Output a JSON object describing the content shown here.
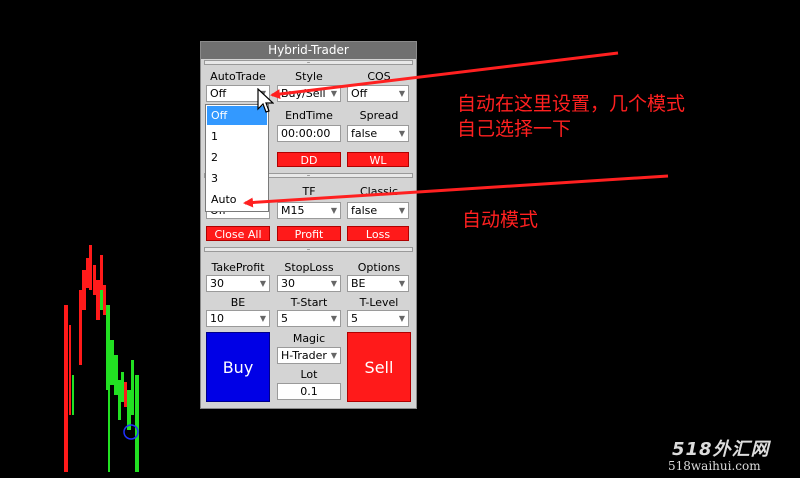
{
  "colors": {
    "accent_red": "#ff1a1a",
    "buy_blue": "#0000e6",
    "panel_bg": "#d4d4d4",
    "annotation": "#ff2020",
    "highlight": "#3399ff"
  },
  "panel": {
    "title": "Hybrid-Trader",
    "sep": "–",
    "row1": {
      "autotrade": {
        "label": "AutoTrade",
        "value": "Off"
      },
      "style": {
        "label": "Style",
        "value": "Buy/Sell"
      },
      "cos": {
        "label": "COS",
        "value": "Off"
      }
    },
    "row2": {
      "endtime": {
        "label": "EndTime",
        "value": "00:00:00"
      },
      "spread": {
        "label": "Spread",
        "value": "false"
      }
    },
    "buttons1": {
      "dd": "DD",
      "wl": "WL"
    },
    "row3": {
      "tf": {
        "label": "TF",
        "value": "M15"
      },
      "classic": {
        "label": "Classic",
        "value": "false"
      },
      "hidden_value": "Off"
    },
    "buttons2": {
      "close_all": "Close All",
      "profit": "Profit",
      "loss": "Loss"
    },
    "row4": {
      "takeprofit": {
        "label": "TakeProfit",
        "value": "30"
      },
      "stoploss": {
        "label": "StopLoss",
        "value": "30"
      },
      "options": {
        "label": "Options",
        "value": "BE"
      }
    },
    "row5": {
      "be": {
        "label": "BE",
        "value": "10"
      },
      "tstart": {
        "label": "T-Start",
        "value": "5"
      },
      "tlevel": {
        "label": "T-Level",
        "value": "5"
      }
    },
    "buy": "Buy",
    "sell": "Sell",
    "magic": {
      "label": "Magic",
      "value": "H-Trader"
    },
    "lot": {
      "label": "Lot",
      "value": "0.1"
    }
  },
  "dropdown": {
    "items": [
      "Off",
      "1",
      "2",
      "3",
      "Auto"
    ],
    "selected": "Off"
  },
  "annotations": {
    "line1": "自动在这里设置，几个模式",
    "line2": "自己选择一下",
    "auto_mode": "自动模式"
  },
  "watermark": {
    "logo": "518外汇网",
    "url": "518waihui.com"
  },
  "icons": {
    "cursor": "mouse-pointer-icon",
    "dropdown_arrow": "chevron-down-icon"
  }
}
